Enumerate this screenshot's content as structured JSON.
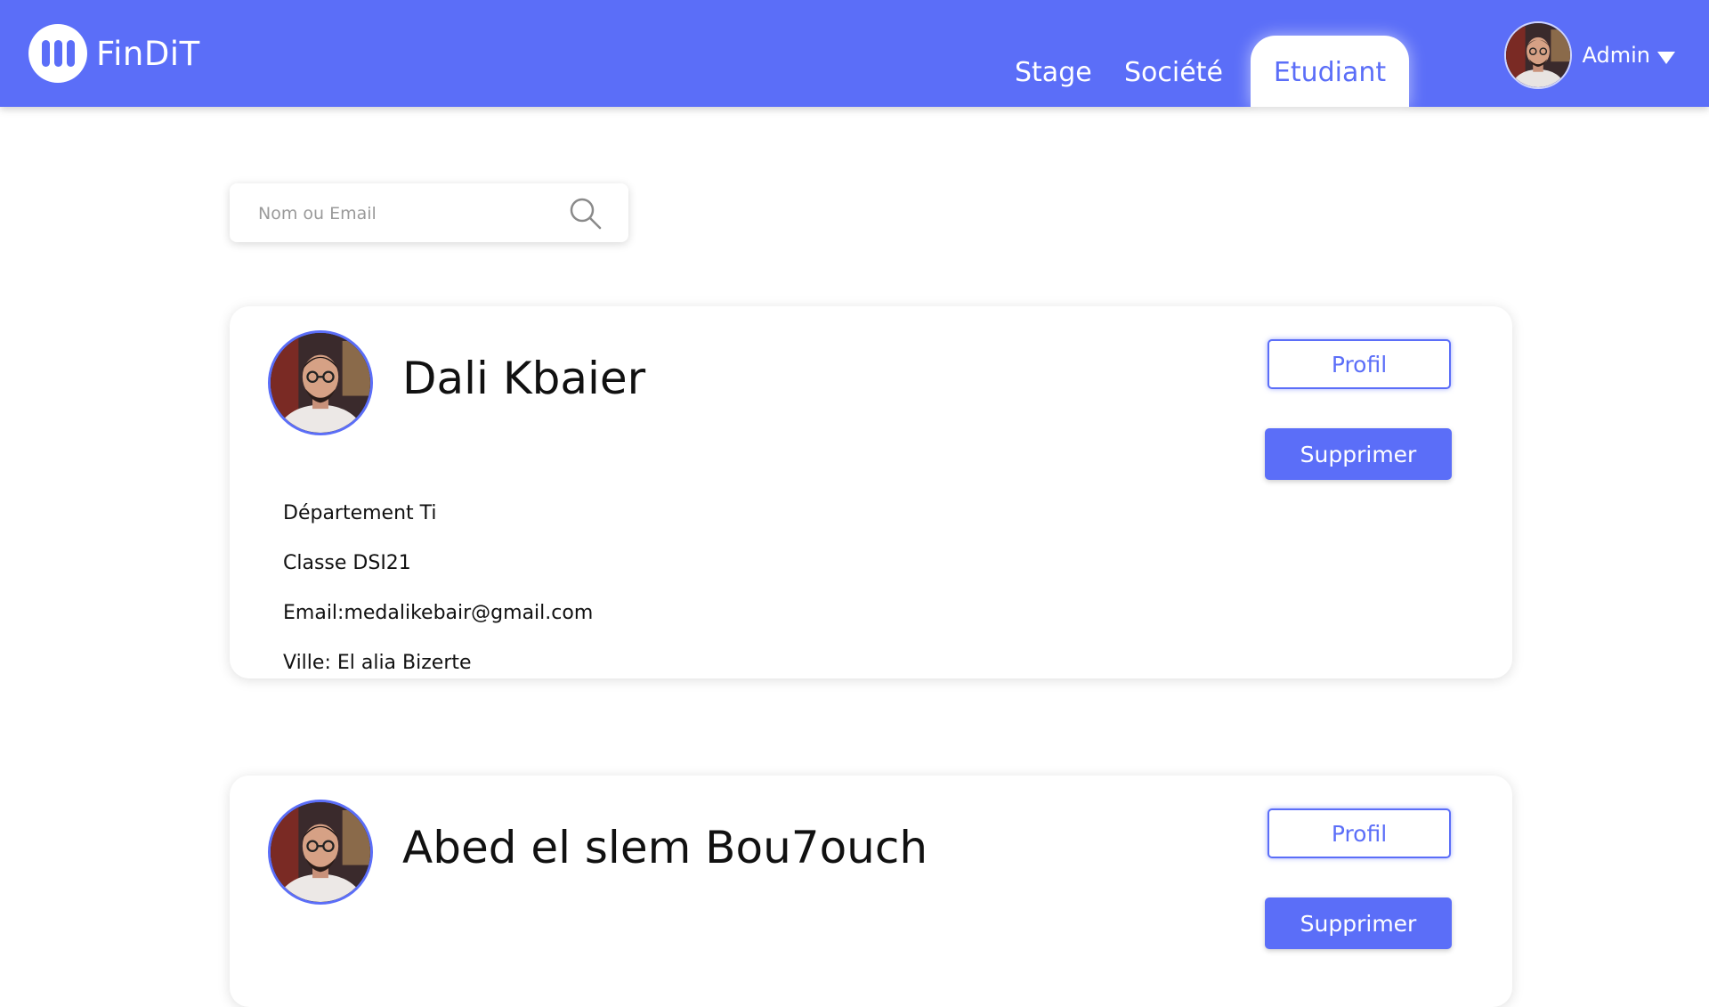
{
  "app": {
    "name": "FinDiT"
  },
  "nav": {
    "items": [
      {
        "label": "Stage"
      },
      {
        "label": "Société"
      },
      {
        "label": "Etudiant",
        "active": true
      }
    ]
  },
  "user": {
    "name": "Admin"
  },
  "search": {
    "placeholder": "Nom ou Email",
    "value": ""
  },
  "students": [
    {
      "name": "Dali Kbaier",
      "departement": "Département Ti",
      "classe": "Classe DSI21",
      "email": "Email:medalikebair@gmail.com",
      "ville": "Ville: El alia Bizerte",
      "profil_label": "Profil",
      "supprimer_label": "Supprimer"
    },
    {
      "name": "Abed el slem Bou7ouch",
      "profil_label": "Profil",
      "supprimer_label": "Supprimer"
    }
  ],
  "colors": {
    "accent": "#5B6EF8",
    "background": "#FFFFFF"
  }
}
